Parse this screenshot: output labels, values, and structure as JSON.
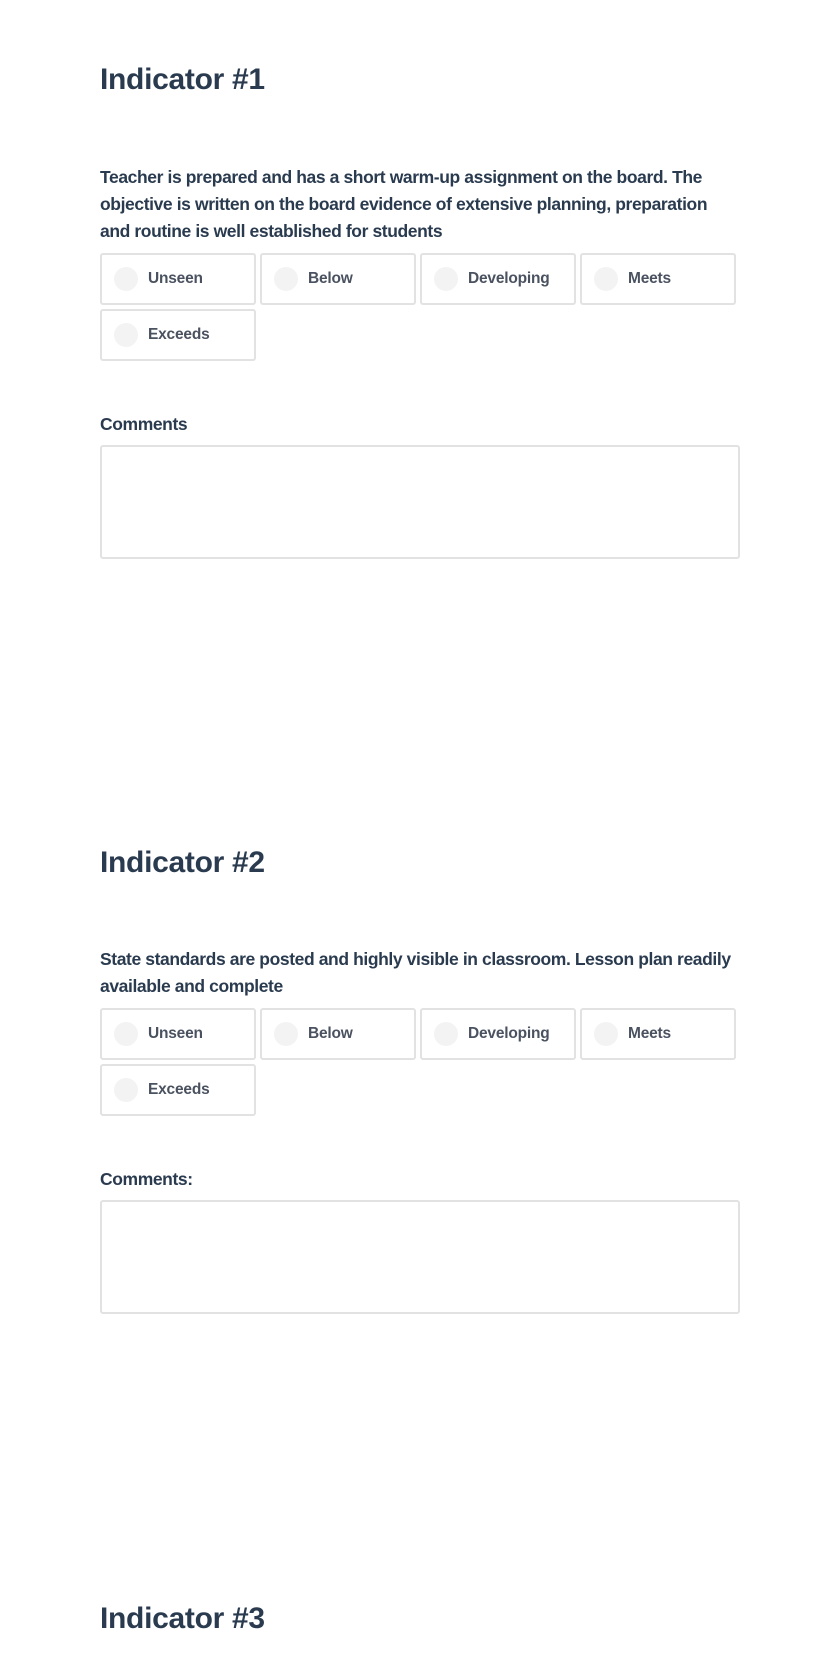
{
  "indicators": [
    {
      "title": "Indicator #1",
      "description": "Teacher is prepared and has a short warm-up assignment on the board. The objective is written on the board evidence of extensive planning, preparation and routine is well established for students",
      "options": [
        "Unseen",
        "Below",
        "Developing",
        "Meets",
        "Exceeds"
      ],
      "selected": null,
      "comments_label": "Comments",
      "comments_value": ""
    },
    {
      "title": "Indicator #2",
      "description": "State standards are posted and highly visible in classroom. Lesson plan readily available and complete",
      "options": [
        "Unseen",
        "Below",
        "Developing",
        "Meets",
        "Exceeds"
      ],
      "selected": null,
      "comments_label": "Comments:",
      "comments_value": ""
    },
    {
      "title": "Indicator #3"
    }
  ],
  "colors": {
    "heading": "#2a3b4f",
    "option_text": "#4a5260",
    "border": "#e2e2e2",
    "radio_fill": "#f3f3f3",
    "background": "#ffffff"
  }
}
